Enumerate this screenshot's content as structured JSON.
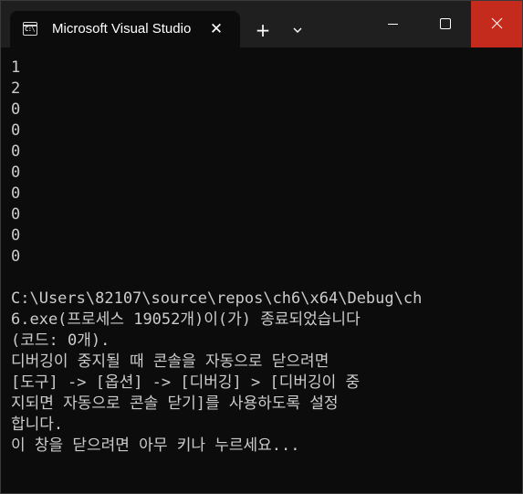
{
  "window": {
    "tab_title": "Microsoft Visual Studio",
    "tab_icon_text": "C:\\",
    "tab_close_label": "✕",
    "new_tab_label": "+"
  },
  "console": {
    "lines": [
      "1",
      "2",
      "0",
      "0",
      "0",
      "0",
      "0",
      "0",
      "0",
      "0",
      "",
      "C:\\Users\\82107\\source\\repos\\ch6\\x64\\Debug\\ch",
      "6.exe(프로세스 19052개)이(가) 종료되었습니다",
      "(코드: 0개).",
      "디버깅이 중지될 때 콘솔을 자동으로 닫으려면",
      "[도구] -> [옵션] -> [디버깅] > [디버깅이 중",
      "지되면 자동으로 콘솔 닫기]를 사용하도록 설정",
      "합니다.",
      "이 창을 닫으려면 아무 키나 누르세요..."
    ]
  },
  "colors": {
    "background": "#0c0c0c",
    "titlebar": "#1f1f1f",
    "text": "#cccccc",
    "close_button": "#c42b1c"
  },
  "icons": {
    "tab_icon": "terminal-icon",
    "tab_close": "close-icon",
    "new_tab": "plus-icon",
    "dropdown": "chevron-down-icon",
    "minimize": "minimize-icon",
    "maximize": "maximize-icon",
    "close": "close-icon"
  }
}
